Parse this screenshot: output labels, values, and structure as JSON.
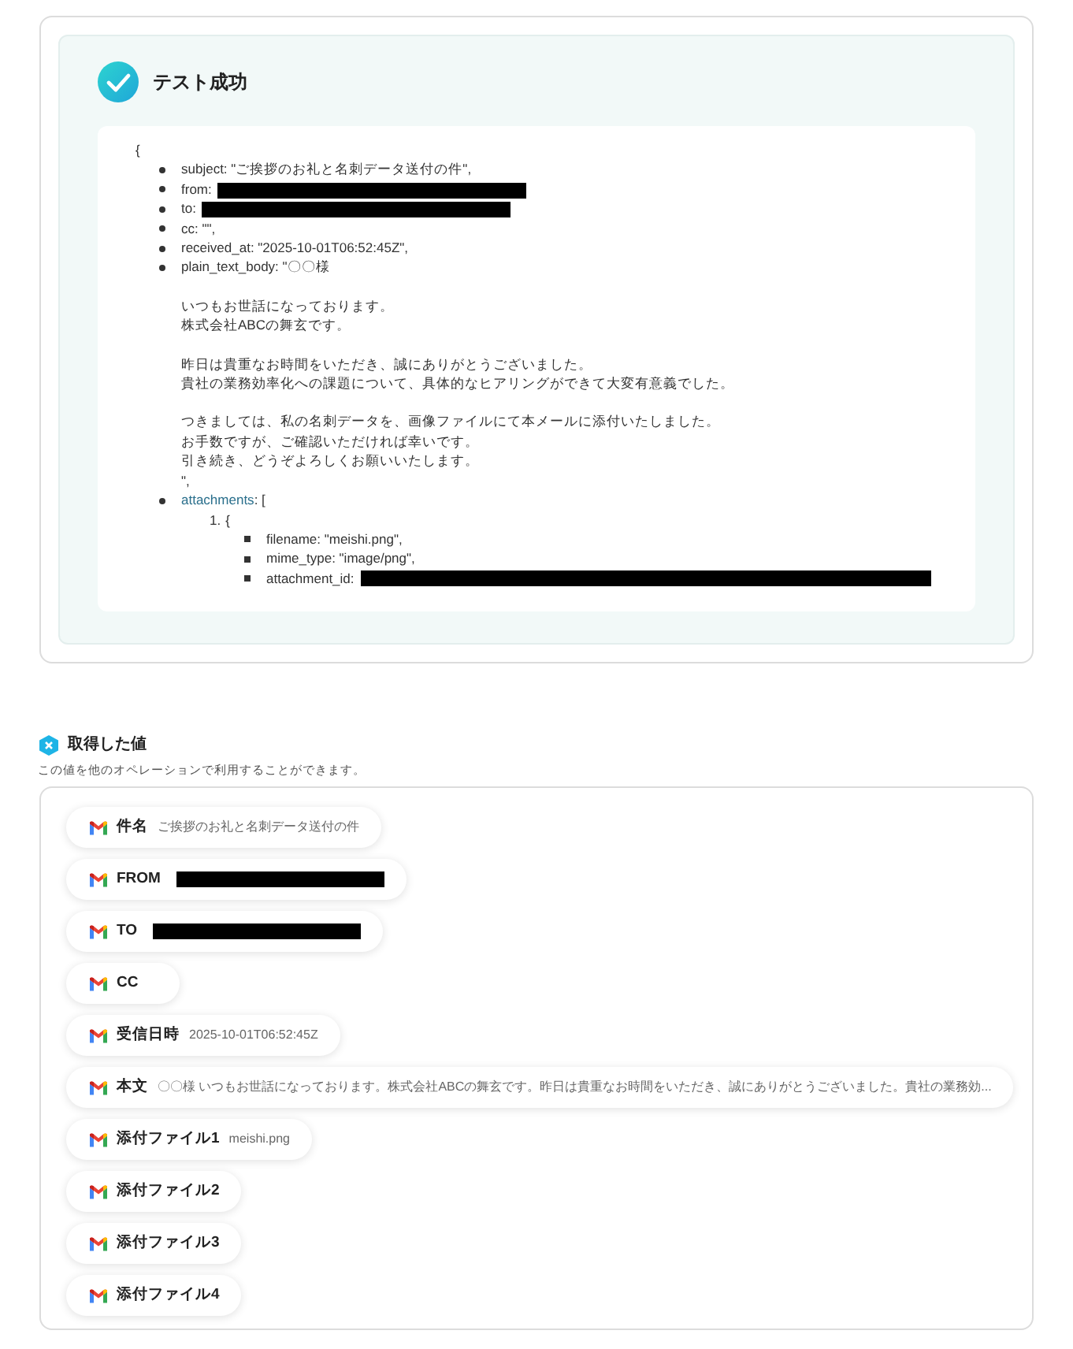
{
  "result": {
    "title": "テスト成功",
    "open": "{",
    "fields": [
      {
        "kind": "text",
        "text": "subject: \"ご挨拶のお礼と名刺データ送付の件\","
      },
      {
        "kind": "redacted",
        "text": "from:"
      },
      {
        "kind": "redacted",
        "text": "to:"
      },
      {
        "kind": "text",
        "text": "cc: \"\","
      },
      {
        "kind": "text",
        "text": "received_at: \"2025-10-01T06:52:45Z\","
      },
      {
        "kind": "body",
        "text": "plain_text_body: \"〇〇様",
        "paragraphs": [
          [
            "いつもお世話になっております。",
            "株式会社ABCの舞玄です。"
          ],
          [
            "昨日は貴重なお時間をいただき、誠にありがとうございました。",
            "貴社の業務効率化への課題について、具体的なヒアリングができて大変有意義でした。"
          ],
          [
            "つきましては、私の名刺データを、画像ファイルにて本メールに添付いたしました。",
            "お手数ですが、ご確認いただければ幸いです。",
            "引き続き、どうぞよろしくお願いいたします。"
          ]
        ],
        "closing": "\","
      },
      {
        "kind": "array",
        "key": "attachments",
        "text": ": [",
        "items": [
          {
            "number": "1.",
            "open": "{",
            "fields": [
              {
                "kind": "text",
                "text": "filename: \"meishi.png\","
              },
              {
                "kind": "text",
                "text": "mime_type: \"image/png\","
              },
              {
                "kind": "redacted",
                "text": "attachment_id:"
              }
            ]
          }
        ]
      }
    ]
  },
  "values": {
    "title": "取得した値",
    "subtitle": "この値を他のオペレーションで利用することができます。",
    "chips": [
      {
        "label": "件名",
        "value": "ご挨拶のお礼と名刺データ送付の件",
        "redacted": false
      },
      {
        "label": "FROM",
        "redacted": true
      },
      {
        "label": "TO",
        "redacted": true
      },
      {
        "label": "CC",
        "redacted": false
      },
      {
        "label": "受信日時",
        "value": "2025-10-01T06:52:45Z",
        "redacted": false
      },
      {
        "label": "本文",
        "value": "〇〇様 いつもお世話になっております。株式会社ABCの舞玄です。昨日は貴重なお時間をいただき、誠にありがとうございました。貴社の業務効...",
        "redacted": false
      },
      {
        "label": "添付ファイル1",
        "value": "meishi.png",
        "redacted": false
      },
      {
        "label": "添付ファイル2",
        "redacted": false
      },
      {
        "label": "添付ファイル3",
        "redacted": false
      },
      {
        "label": "添付ファイル4",
        "redacted": false
      }
    ]
  }
}
